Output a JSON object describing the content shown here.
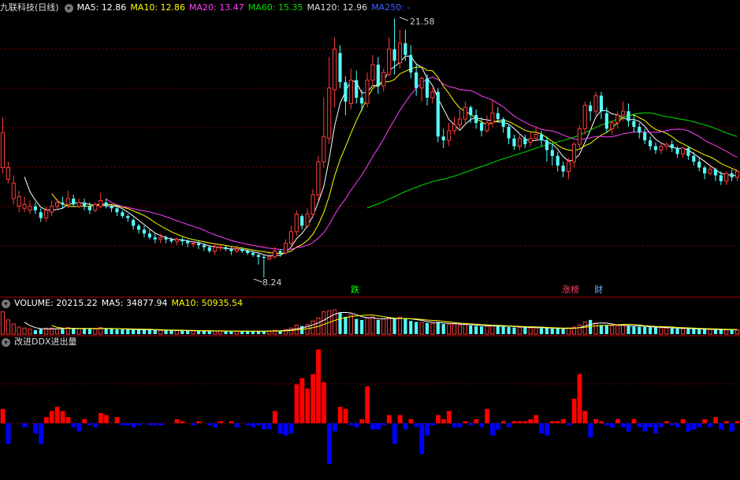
{
  "stock": {
    "title": "九联科技(日线)"
  },
  "indicators": {
    "ma5": "MA5: 12.86",
    "ma10": "MA10: 12.86",
    "ma20": "MA20: 13.47",
    "ma60": "MA60: 15.35",
    "ma120": "MA120: 12.96",
    "ma250": "MA250: -"
  },
  "volume_header": {
    "volume": "VOLUME: 20215.22",
    "ma5": "MA5: 34877.94",
    "ma10": "MA10: 50935.54"
  },
  "ddx_header": {
    "title": "改进DDX进出量"
  },
  "annotations": {
    "high": "21.58",
    "low": "8.24"
  },
  "markers": {
    "m1": "跌",
    "m2": "涨榜",
    "m3": "财"
  },
  "colors": {
    "up": "#ff3c3c",
    "down": "#54ffff",
    "ma5": "#ffffff",
    "ma10": "#ffff00",
    "ma20": "#ff40ff",
    "ma60": "#00e000",
    "ma120": "#dddddd",
    "ma250": "#4060ff",
    "grid": "#7a0000",
    "ddx_pos": "#ff0000",
    "ddx_neg": "#0000ff"
  },
  "chart_data": {
    "type": "candlestick",
    "y_range": [
      8.24,
      21.58
    ],
    "max_label": 21.58,
    "min_label": 8.24,
    "candles": [
      [
        13.9,
        15.7,
        16.5,
        13.6
      ],
      [
        13.3,
        13.9,
        14.2,
        13.1
      ],
      [
        12.3,
        13.1,
        13.5,
        12.0
      ],
      [
        11.9,
        12.4,
        12.7,
        11.6
      ],
      [
        11.8,
        12.0,
        12.4,
        11.6
      ],
      [
        11.7,
        11.9,
        12.2,
        11.5
      ],
      [
        11.9,
        11.7,
        12.1,
        11.5
      ],
      [
        11.6,
        11.3,
        11.8,
        11.1
      ],
      [
        11.3,
        11.7,
        11.9,
        11.1
      ],
      [
        11.6,
        11.9,
        12.2,
        11.4
      ],
      [
        11.9,
        12.1,
        12.3,
        11.7
      ],
      [
        12.1,
        12.0,
        12.4,
        11.8
      ],
      [
        12.0,
        12.3,
        12.7,
        11.8
      ],
      [
        12.3,
        12.0,
        12.5,
        11.9
      ],
      [
        11.9,
        12.1,
        12.3,
        11.8
      ],
      [
        12.1,
        11.9,
        12.3,
        11.7
      ],
      [
        11.9,
        11.7,
        12.1,
        11.5
      ],
      [
        11.7,
        12.0,
        12.1,
        11.6
      ],
      [
        11.9,
        12.2,
        12.6,
        11.8
      ],
      [
        12.1,
        11.9,
        12.3,
        11.8
      ],
      [
        11.9,
        11.8,
        12.0,
        11.6
      ],
      [
        11.8,
        11.6,
        11.9,
        11.4
      ],
      [
        11.6,
        11.4,
        11.7,
        11.3
      ],
      [
        11.4,
        11.3,
        11.5,
        11.1
      ],
      [
        11.2,
        10.9,
        11.3,
        10.7
      ],
      [
        10.9,
        10.7,
        11.0,
        10.5
      ],
      [
        10.7,
        10.5,
        10.9,
        10.3
      ],
      [
        10.5,
        10.3,
        10.7,
        10.2
      ],
      [
        10.3,
        10.2,
        10.5,
        10.0
      ],
      [
        10.2,
        10.3,
        10.5,
        10.0
      ],
      [
        10.3,
        10.2,
        10.4,
        10.0
      ],
      [
        10.2,
        10.1,
        10.3,
        10.0
      ],
      [
        10.1,
        10.2,
        10.3,
        9.9
      ],
      [
        10.2,
        10.1,
        10.3,
        9.9
      ],
      [
        10.1,
        10.0,
        10.2,
        9.8
      ],
      [
        10.0,
        10.0,
        10.1,
        9.8
      ],
      [
        10.0,
        9.9,
        10.1,
        9.7
      ],
      [
        9.9,
        9.8,
        10.0,
        9.6
      ],
      [
        9.8,
        9.6,
        9.9,
        9.5
      ],
      [
        9.6,
        9.8,
        10.0,
        9.4
      ],
      [
        9.8,
        9.8,
        9.9,
        9.6
      ],
      [
        9.8,
        9.7,
        9.9,
        9.6
      ],
      [
        9.7,
        9.6,
        9.8,
        9.4
      ],
      [
        9.6,
        9.7,
        9.9,
        9.5
      ],
      [
        9.7,
        9.6,
        9.8,
        9.5
      ],
      [
        9.6,
        9.5,
        9.7,
        9.4
      ],
      [
        9.5,
        9.4,
        9.6,
        9.3
      ],
      [
        9.4,
        9.3,
        9.5,
        8.9
      ],
      [
        9.3,
        9.25,
        9.4,
        8.24
      ],
      [
        9.2,
        9.3,
        9.6,
        9.1
      ],
      [
        9.3,
        9.6,
        9.8,
        9.2
      ],
      [
        9.6,
        9.5,
        9.7,
        9.3
      ],
      [
        9.5,
        10.0,
        10.2,
        9.4
      ],
      [
        10.0,
        10.6,
        10.9,
        9.8
      ],
      [
        10.6,
        11.5,
        11.7,
        10.4
      ],
      [
        11.4,
        10.9,
        11.5,
        10.7
      ],
      [
        10.9,
        11.5,
        11.8,
        10.8
      ],
      [
        11.5,
        12.5,
        12.8,
        11.3
      ],
      [
        12.5,
        14.2,
        14.5,
        12.2
      ],
      [
        14.2,
        15.5,
        17.5,
        13.9
      ],
      [
        15.4,
        18.0,
        19.6,
        15.1
      ],
      [
        17.9,
        20.0,
        20.6,
        17.0
      ],
      [
        19.8,
        18.3,
        20.2,
        18.0
      ],
      [
        18.3,
        17.3,
        18.6,
        16.6
      ],
      [
        17.2,
        18.4,
        19.0,
        16.9
      ],
      [
        18.4,
        17.5,
        18.9,
        17.2
      ],
      [
        17.5,
        17.2,
        17.9,
        16.8
      ],
      [
        17.2,
        18.4,
        18.8,
        17.0
      ],
      [
        18.4,
        19.2,
        19.7,
        18.1
      ],
      [
        19.2,
        18.1,
        19.6,
        17.7
      ],
      [
        18.1,
        18.8,
        19.0,
        17.8
      ],
      [
        18.7,
        20.0,
        20.6,
        18.6
      ],
      [
        20.0,
        19.4,
        21.58,
        18.7
      ],
      [
        19.3,
        20.3,
        21.0,
        19.0
      ],
      [
        20.3,
        19.7,
        21.0,
        19.4
      ],
      [
        19.7,
        18.8,
        20.2,
        18.5
      ],
      [
        18.8,
        18.0,
        19.2,
        17.6
      ],
      [
        18.0,
        18.5,
        18.6,
        17.3
      ],
      [
        18.5,
        17.5,
        18.7,
        17.1
      ],
      [
        17.5,
        17.8,
        18.0,
        17.2
      ],
      [
        17.8,
        15.5,
        18.0,
        15.2
      ],
      [
        15.5,
        15.3,
        15.9,
        14.9
      ],
      [
        15.3,
        15.8,
        16.2,
        15.0
      ],
      [
        15.8,
        16.1,
        16.5,
        15.6
      ],
      [
        16.1,
        16.4,
        16.9,
        15.9
      ],
      [
        16.4,
        17.0,
        17.3,
        16.1
      ],
      [
        17.0,
        16.6,
        17.1,
        16.2
      ],
      [
        16.6,
        16.2,
        16.9,
        15.9
      ],
      [
        16.2,
        15.8,
        16.5,
        15.5
      ],
      [
        15.8,
        16.2,
        16.6,
        15.7
      ],
      [
        16.2,
        16.7,
        17.4,
        16.0
      ],
      [
        16.7,
        16.4,
        17.0,
        16.2
      ],
      [
        16.4,
        16.0,
        16.5,
        15.7
      ],
      [
        16.0,
        15.4,
        16.1,
        15.1
      ],
      [
        15.4,
        15.0,
        15.6,
        14.8
      ],
      [
        15.0,
        15.4,
        15.6,
        14.8
      ],
      [
        15.4,
        15.1,
        15.6,
        14.9
      ],
      [
        15.2,
        15.4,
        15.7,
        15.0
      ],
      [
        15.4,
        15.6,
        16.0,
        15.3
      ],
      [
        15.6,
        15.3,
        15.8,
        15.0
      ],
      [
        15.3,
        14.8,
        15.5,
        14.2
      ],
      [
        14.8,
        14.5,
        15.1,
        14.0
      ],
      [
        14.5,
        14.0,
        14.7,
        13.7
      ],
      [
        14.0,
        13.7,
        14.2,
        13.4
      ],
      [
        13.7,
        14.2,
        14.4,
        13.3
      ],
      [
        14.2,
        15.1,
        15.2,
        13.9
      ],
      [
        15.1,
        15.9,
        16.1,
        14.9
      ],
      [
        15.9,
        17.1,
        17.3,
        15.6
      ],
      [
        17.1,
        16.8,
        17.3,
        16.3
      ],
      [
        16.8,
        17.6,
        17.8,
        16.5
      ],
      [
        17.6,
        16.8,
        17.8,
        16.4
      ],
      [
        16.7,
        15.9,
        17.0,
        15.7
      ],
      [
        15.9,
        16.2,
        16.3,
        15.6
      ],
      [
        16.2,
        16.6,
        16.8,
        15.9
      ],
      [
        16.6,
        16.8,
        17.3,
        16.3
      ],
      [
        16.8,
        16.3,
        17.2,
        16.0
      ],
      [
        16.3,
        16.0,
        16.6,
        15.7
      ],
      [
        16.0,
        15.7,
        16.2,
        15.4
      ],
      [
        15.7,
        15.3,
        15.9,
        15.1
      ],
      [
        15.3,
        15.0,
        15.5,
        14.8
      ],
      [
        15.0,
        14.8,
        15.2,
        14.6
      ],
      [
        14.8,
        15.0,
        15.1,
        14.6
      ],
      [
        15.0,
        15.1,
        15.2,
        14.8
      ],
      [
        15.1,
        14.9,
        15.3,
        14.7
      ],
      [
        14.9,
        14.6,
        15.0,
        14.4
      ],
      [
        14.6,
        14.9,
        15.0,
        14.4
      ],
      [
        14.9,
        14.5,
        15.0,
        14.3
      ],
      [
        14.5,
        14.2,
        14.7,
        14.0
      ],
      [
        14.2,
        13.9,
        14.4,
        13.7
      ],
      [
        13.9,
        13.6,
        14.0,
        13.3
      ],
      [
        13.6,
        13.8,
        14.0,
        13.5
      ],
      [
        13.8,
        13.5,
        13.9,
        13.2
      ],
      [
        13.5,
        13.2,
        13.7,
        13.0
      ],
      [
        13.2,
        13.6,
        13.7,
        13.0
      ],
      [
        13.6,
        13.4,
        13.8,
        13.2
      ],
      [
        13.4,
        13.7,
        13.8,
        13.2
      ]
    ],
    "volume": [
      22000,
      14000,
      10000,
      7000,
      6000,
      5000,
      4000,
      5000,
      6000,
      6000,
      5500,
      5000,
      6500,
      6000,
      5500,
      5200,
      5000,
      5200,
      6500,
      5500,
      5000,
      4800,
      4600,
      4500,
      4700,
      4300,
      4200,
      4000,
      3900,
      3800,
      3700,
      3600,
      3500,
      3400,
      3300,
      3200,
      3100,
      3000,
      3200,
      3100,
      3000,
      2900,
      2900,
      3000,
      2900,
      2800,
      2800,
      2900,
      3400,
      3300,
      3800,
      3500,
      4500,
      6000,
      9000,
      8000,
      9500,
      13000,
      16000,
      22000,
      23000,
      24000,
      21000,
      17000,
      19000,
      15000,
      14000,
      16000,
      17000,
      14000,
      15000,
      16000,
      15000,
      16500,
      15000,
      13000,
      12000,
      11500,
      11000,
      10500,
      12000,
      10000,
      9500,
      10000,
      9000,
      9500,
      8500,
      8000,
      7500,
      8000,
      8500,
      8000,
      7500,
      7000,
      6500,
      6800,
      6500,
      6300,
      6200,
      6000,
      5800,
      5600,
      5400,
      5200,
      6000,
      7000,
      9000,
      12000,
      14000,
      11000,
      9000,
      8500,
      8000,
      8500,
      9000,
      8000,
      7500,
      7200,
      7000,
      6800,
      6500,
      6300,
      6000,
      5800,
      5600,
      5400,
      5200,
      5000,
      4800,
      4700,
      4600,
      4500,
      4400,
      4300,
      4200,
      4100
    ],
    "ddx": [
      0.7,
      -1.0,
      0,
      0,
      -0.2,
      0,
      -0.5,
      -1.0,
      0.3,
      0.6,
      0.8,
      0.6,
      0.3,
      -0.2,
      -0.4,
      0.2,
      -0.1,
      -0.2,
      0.5,
      0.4,
      0,
      0.3,
      -0.1,
      -0.1,
      -0.2,
      -0.1,
      0,
      -0.1,
      -0.1,
      -0.1,
      0,
      0,
      0.2,
      0.1,
      0,
      -0.1,
      0.1,
      0,
      -0.1,
      -0.2,
      0.1,
      0,
      0.1,
      -0.2,
      0,
      -0.1,
      -0.2,
      -0.1,
      -0.3,
      -0.3,
      0.6,
      -0.5,
      -0.6,
      -0.5,
      1.9,
      2.2,
      1.7,
      2.4,
      3.6,
      2.0,
      -2.0,
      -0.4,
      0.8,
      0.7,
      -0.1,
      -0.2,
      0.2,
      1.8,
      -0.3,
      -0.3,
      -0.1,
      0.4,
      -1.0,
      0.4,
      -0.3,
      0.2,
      -0.2,
      -1.5,
      -0.6,
      -0.1,
      0.4,
      0.2,
      0.6,
      -0.2,
      -0.2,
      0.1,
      -0.1,
      0.2,
      -0.2,
      0.7,
      -0.6,
      -0.3,
      0.1,
      -0.2,
      0.1,
      0.1,
      0.1,
      0.2,
      0.4,
      -0.5,
      -0.6,
      0.1,
      0.1,
      0.2,
      -0.1,
      1.2,
      2.4,
      0.6,
      -0.7,
      0.2,
      0.1,
      -0.1,
      -0.2,
      0.2,
      -0.2,
      -0.4,
      0.2,
      -0.2,
      -0.4,
      -0.2,
      -0.5,
      -0.2,
      0.1,
      -0.1,
      -0.2,
      0.2,
      -0.4,
      -0.3,
      -0.2,
      0.2,
      -0.2,
      0.3,
      -0.3,
      0.1,
      -0.4,
      0.1
    ]
  }
}
